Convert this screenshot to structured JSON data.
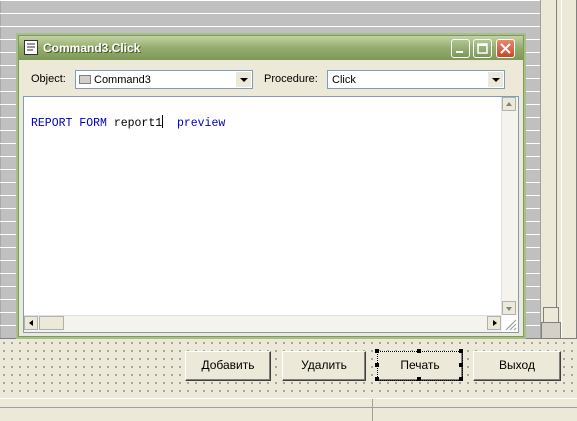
{
  "window": {
    "title": "Command3.Click",
    "object_label": "Object:",
    "object_value": "Command3",
    "procedure_label": "Procedure:",
    "procedure_value": "Click"
  },
  "code": {
    "kw1": "REPORT FORM",
    "arg": "report1",
    "kw2": "preview"
  },
  "form_buttons": {
    "add": "Добавить",
    "delete": "Удалить",
    "print": "Печать",
    "exit": "Выход"
  },
  "colors": {
    "title_bar": "#94ac6c",
    "keyword": "#0000c0",
    "close_button": "#c4482a"
  }
}
